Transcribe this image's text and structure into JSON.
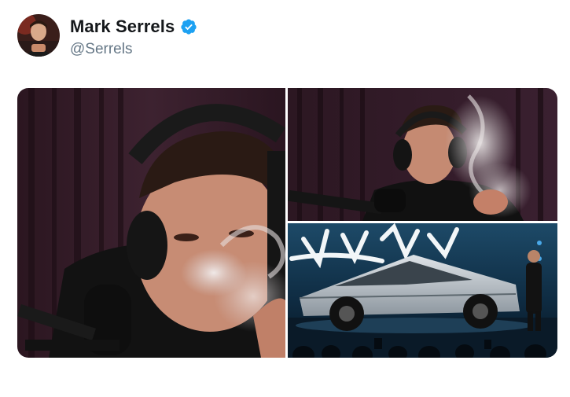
{
  "tweet": {
    "author": {
      "display_name": "Mark Serrels",
      "handle": "@Serrels",
      "verified": true,
      "avatar_icon": "profile-photo"
    },
    "media": [
      {
        "name": "photo-smoking-podcast-closeup",
        "icon": "photo"
      },
      {
        "name": "photo-smoking-podcast-wide",
        "icon": "photo"
      },
      {
        "name": "photo-cybertruck-reveal",
        "icon": "photo"
      }
    ]
  },
  "colors": {
    "name_text": "#14171a",
    "handle_text": "#657786",
    "verified_badge": "#1da1f2",
    "background": "#ffffff"
  }
}
